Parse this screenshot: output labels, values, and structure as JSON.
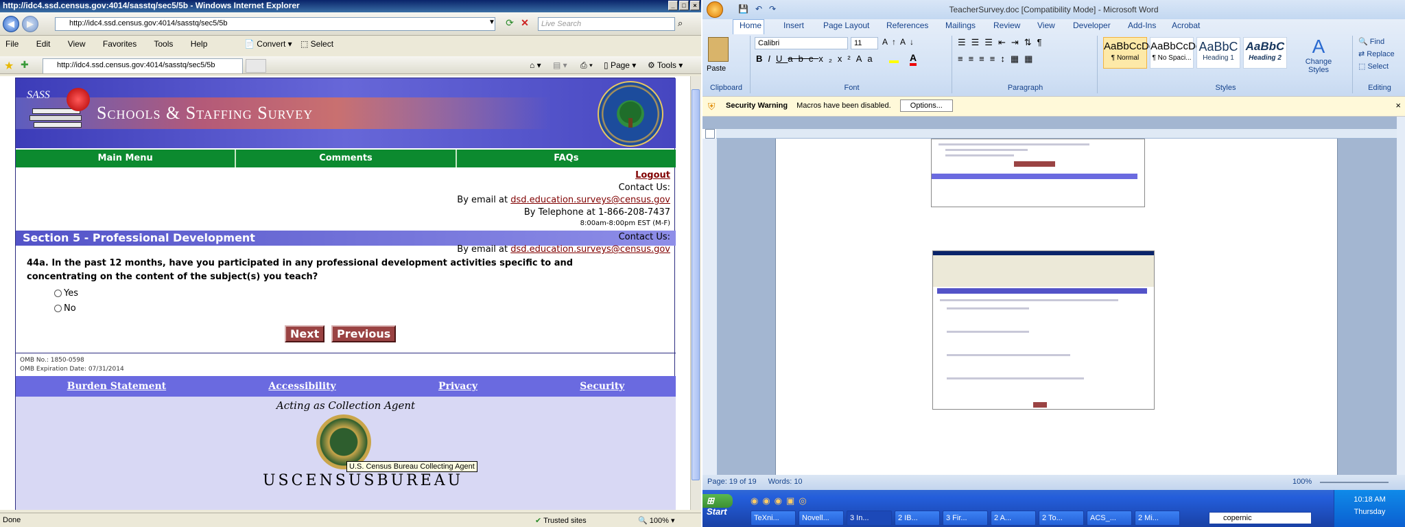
{
  "ie": {
    "title": "http://idc4.ssd.census.gov:4014/sasstq/sec5/5b - Windows Internet Explorer",
    "url": "http://idc4.ssd.census.gov:4014/sasstq/sec5/5b",
    "search_placeholder": "Live Search",
    "menu": [
      "File",
      "Edit",
      "View",
      "Favorites",
      "Tools",
      "Help"
    ],
    "convert": "Convert",
    "select": "Select",
    "tab_url": "http://idc4.ssd.census.gov:4014/sasstq/sec5/5b",
    "page_menu": "Page",
    "tools_menu": "Tools",
    "status": "Done",
    "zone": "Trusted sites",
    "zoom": "100%"
  },
  "site": {
    "sass": "SASS",
    "title": "Schools & Staffing Survey",
    "nav": [
      "Main Menu",
      "Comments",
      "FAQs"
    ],
    "logout": "Logout",
    "contact": "Contact Us:",
    "email_prefix": "By email at ",
    "email": "dsd.education.surveys@census.gov",
    "phone": "By Telephone at 1-866-208-7437",
    "hours": "8:00am-8:00pm EST (M-F)",
    "section": "Section 5 - Professional Development",
    "question_line1": "44a. In the past 12 months, have you participated in any professional development activities specific to and",
    "question_line2": "concentrating on the content of the subject(s) you teach?",
    "yes": "Yes",
    "no": "No",
    "next": "Next",
    "previous": "Previous",
    "omb_no": "OMB No.: 1850-0598",
    "omb_exp": "OMB Expiration Date: 07/31/2014",
    "footer_links": [
      "Burden Statement",
      "Accessibility",
      "Privacy",
      "Security"
    ],
    "agent": "Acting as Collection Agent",
    "tooltip": "U.S. Census Bureau Collecting Agent",
    "bureau": "USCENSUSBUREAU"
  },
  "word": {
    "title": "TeacherSurvey.doc [Compatibility Mode] - Microsoft Word",
    "tabs": [
      "Home",
      "Insert",
      "Page Layout",
      "References",
      "Mailings",
      "Review",
      "View",
      "Developer",
      "Add-Ins",
      "Acrobat"
    ],
    "paste": "Paste",
    "font": "Calibri",
    "size": "11",
    "groups": [
      "Clipboard",
      "Font",
      "Paragraph",
      "Styles",
      "Editing"
    ],
    "styles": [
      {
        "preview": "AaBbCcDc",
        "name": "¶ Normal"
      },
      {
        "preview": "AaBbCcDc",
        "name": "¶ No Spaci..."
      },
      {
        "preview": "AaBbC",
        "name": "Heading 1"
      },
      {
        "preview": "AaBbC",
        "name": "Heading 2"
      }
    ],
    "change_styles": "Change Styles",
    "find": "Find",
    "replace": "Replace",
    "select": "Select",
    "security_title": "Security Warning",
    "security_msg": "Macros have been disabled.",
    "options": "Options...",
    "page_status": "Page: 19 of 19",
    "words": "Words: 10",
    "zoom": "100%"
  },
  "taskbar": {
    "start": "Start",
    "tasks": [
      "TeXni...",
      "Novell...",
      "3 In...",
      "2 IB...",
      "3 Fir...",
      "2 A...",
      "2 To...",
      "ACS_...",
      "2 Mi..."
    ],
    "search": "copernic",
    "time": "10:18 AM",
    "day": "Thursday"
  },
  "colors": {
    "nav_green": "#0c8a2f",
    "section_blue": "#5353c8",
    "button_red": "#9a4343",
    "link": "#800000"
  }
}
